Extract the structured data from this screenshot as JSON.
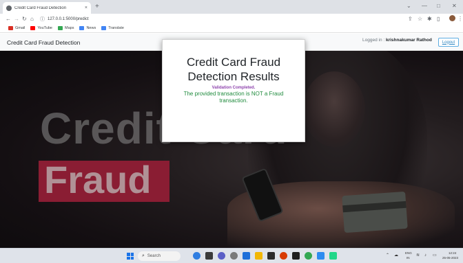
{
  "browser": {
    "tab_title": "Credit Card Fraud Detection",
    "tab_close": "×",
    "new_tab": "+",
    "url": "127.0.0.1:5000/predict",
    "bookmarks": [
      {
        "label": "Gmail",
        "color": "#d93025"
      },
      {
        "label": "YouTube",
        "color": "#ff0000"
      },
      {
        "label": "Maps",
        "color": "#34a853"
      },
      {
        "label": "News",
        "color": "#4285f4"
      },
      {
        "label": "Translate",
        "color": "#4285f4"
      }
    ]
  },
  "navbar": {
    "brand": "Credit Card Fraud Detection",
    "logged_in_label": "Logged in : ",
    "username": "krishnakumar Rathod",
    "logout_label": "Logout"
  },
  "hero": {
    "word_credit": "Credit Card",
    "word_fraud": "Fraud"
  },
  "result": {
    "title": "Credit Card Fraud Detection Results",
    "status": "Validation Completed.",
    "message": "The provided transaction is NOT a Fraud transaction.",
    "status_color": "#8e44ad",
    "message_color": "#1e8a3c"
  },
  "taskbar": {
    "search_label": "Search",
    "apps": [
      {
        "name": "widgets",
        "color": "#2f7de1"
      },
      {
        "name": "task-view",
        "color": "#3a3a3a"
      },
      {
        "name": "chat",
        "color": "#5b5fc7"
      },
      {
        "name": "settings",
        "color": "#7a7a7a"
      },
      {
        "name": "store",
        "color": "#1e6fd9"
      },
      {
        "name": "explorer",
        "color": "#f2b705"
      },
      {
        "name": "terminal",
        "color": "#2b2b2b"
      },
      {
        "name": "office",
        "color": "#d83b01"
      },
      {
        "name": "editor",
        "color": "#1f1f1f"
      },
      {
        "name": "chrome",
        "color": "#34a853"
      },
      {
        "name": "vscode",
        "color": "#2d8cf0"
      },
      {
        "name": "pycharm",
        "color": "#21d789"
      }
    ],
    "language": "ENG",
    "region": "IN",
    "time": "12:24",
    "date": "25-05-2023"
  },
  "colors": {
    "accent": "#2e86c1",
    "navbar_bg": "#f8f9fa",
    "hero_banner": "#8a1d33"
  }
}
